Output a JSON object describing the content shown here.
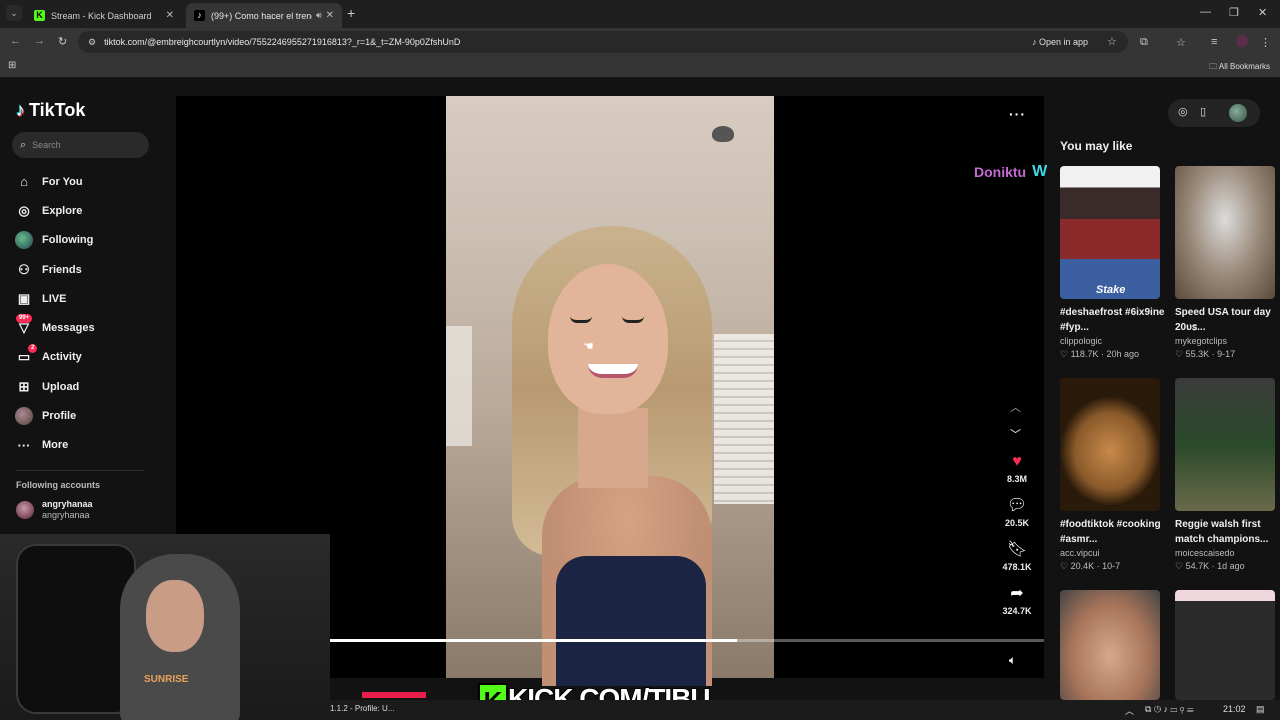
{
  "browser": {
    "tabs": [
      {
        "title": "Stream - Kick Dashboard",
        "favicon": "kick-icon"
      },
      {
        "title": "(99+) Como hacer el trend 'I",
        "favicon": "tiktok-icon"
      }
    ],
    "url": "tiktok.com/@embreighcourtlyn/video/7552246955271916813?_r=1&_t=ZM-90p0ZfshUnD",
    "open_in_app": "Open in app",
    "all_bookmarks": "All Bookmarks"
  },
  "sidebar": {
    "logo": "TikTok",
    "search_placeholder": "Search",
    "nav": [
      {
        "label": "For You",
        "icon": "home-icon"
      },
      {
        "label": "Explore",
        "icon": "compass-icon"
      },
      {
        "label": "Following",
        "icon": "following-avatar-icon"
      },
      {
        "label": "Friends",
        "icon": "friends-icon"
      },
      {
        "label": "LIVE",
        "icon": "live-icon"
      },
      {
        "label": "Messages",
        "icon": "messages-icon",
        "badge": "99+"
      },
      {
        "label": "Activity",
        "icon": "activity-icon",
        "badge": "2"
      },
      {
        "label": "Upload",
        "icon": "upload-icon"
      },
      {
        "label": "Profile",
        "icon": "profile-avatar-icon"
      },
      {
        "label": "More",
        "icon": "more-icon"
      }
    ],
    "following_header": "Following accounts",
    "following_accounts": [
      {
        "name": "angryhanaa",
        "handle": "angryhanaa"
      }
    ]
  },
  "video": {
    "watermark": "Doniktu",
    "likes": "8.3M",
    "comments": "20.5K",
    "saves": "478.1K",
    "shares": "324.7K",
    "progress": 0.57
  },
  "recommendations": {
    "title": "You may like",
    "items": [
      {
        "caption": "#deshaefrost #6ix9ine #fyp...",
        "author": "clippologic",
        "likes": "118.7K",
        "age": "20h ago"
      },
      {
        "caption": "Speed USA tour day 20ᴜꜱ...",
        "author": "mykegotclips",
        "likes": "55.3K",
        "age": "9-17"
      },
      {
        "caption": "#foodtiktok #cooking #asmr...",
        "author": "acc.vipcui",
        "likes": "20.4K",
        "age": "10-7"
      },
      {
        "caption": "Reggie walsh first match champions...",
        "author": "moicescaisedo",
        "likes": "54.7K",
        "age": "1d ago"
      },
      {
        "caption": "",
        "author": "",
        "likes": "",
        "age": ""
      },
      {
        "caption": "",
        "author": "",
        "likes": "",
        "age": ""
      }
    ]
  },
  "overlay": {
    "kick_banner": "KICK.COM/TIBU",
    "kick_letter": "K",
    "taskbar_item": "1.1.2 - Profile: U...",
    "clock": "21:02",
    "webcam_hoodie_text": "SUNRISE"
  },
  "colors": {
    "accent": "#fe2c55",
    "kick_green": "#53fc18",
    "watermark": "#c46ad0"
  }
}
